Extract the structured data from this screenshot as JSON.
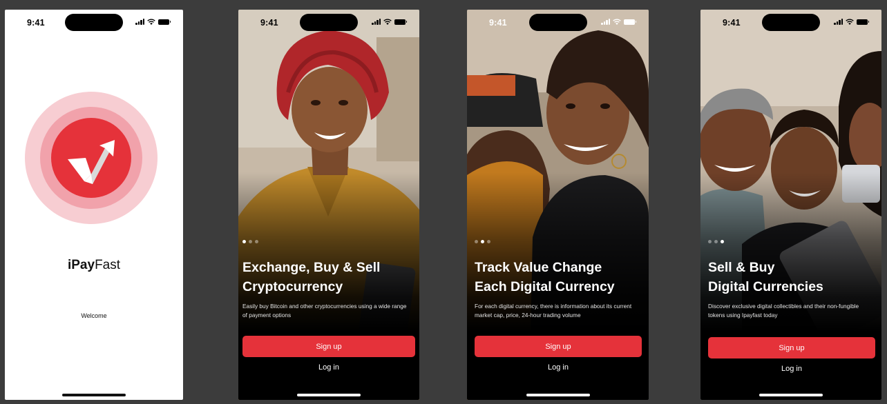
{
  "status_time": "9:41",
  "colors": {
    "accent": "#e5323a",
    "canvas": "#3c3c3c"
  },
  "icons": [
    "cellular-signal-icon",
    "wifi-icon",
    "battery-icon",
    "ipayfast-logo-icon"
  ],
  "splash": {
    "brand_bold": "iPay",
    "brand_light": "Fast",
    "welcome": "Welcome"
  },
  "onboarding": [
    {
      "title_line1": "Exchange, Buy & Sell",
      "title_line2": "Cryptocurrency",
      "description": "Easily buy Bitcoin and other cryptocurrencies using a wide range of payment options",
      "active_page": 1,
      "page_count": 3,
      "signup_label": "Sign up",
      "login_label": "Log in"
    },
    {
      "title_line1": "Track Value Change",
      "title_line2": "Each Digital Currency",
      "description": "For each digital currency, there is information about its current market cap, price, 24-hour trading volume",
      "active_page": 2,
      "page_count": 3,
      "signup_label": "Sign up",
      "login_label": "Log in"
    },
    {
      "title_line1": "Sell & Buy",
      "title_line2": "Digital Currencies",
      "description": "Discover exclusive digital collectibles and their non-fungible tokens using Ipayfast today",
      "active_page": 3,
      "page_count": 3,
      "signup_label": "Sign up",
      "login_label": "Log in"
    }
  ]
}
